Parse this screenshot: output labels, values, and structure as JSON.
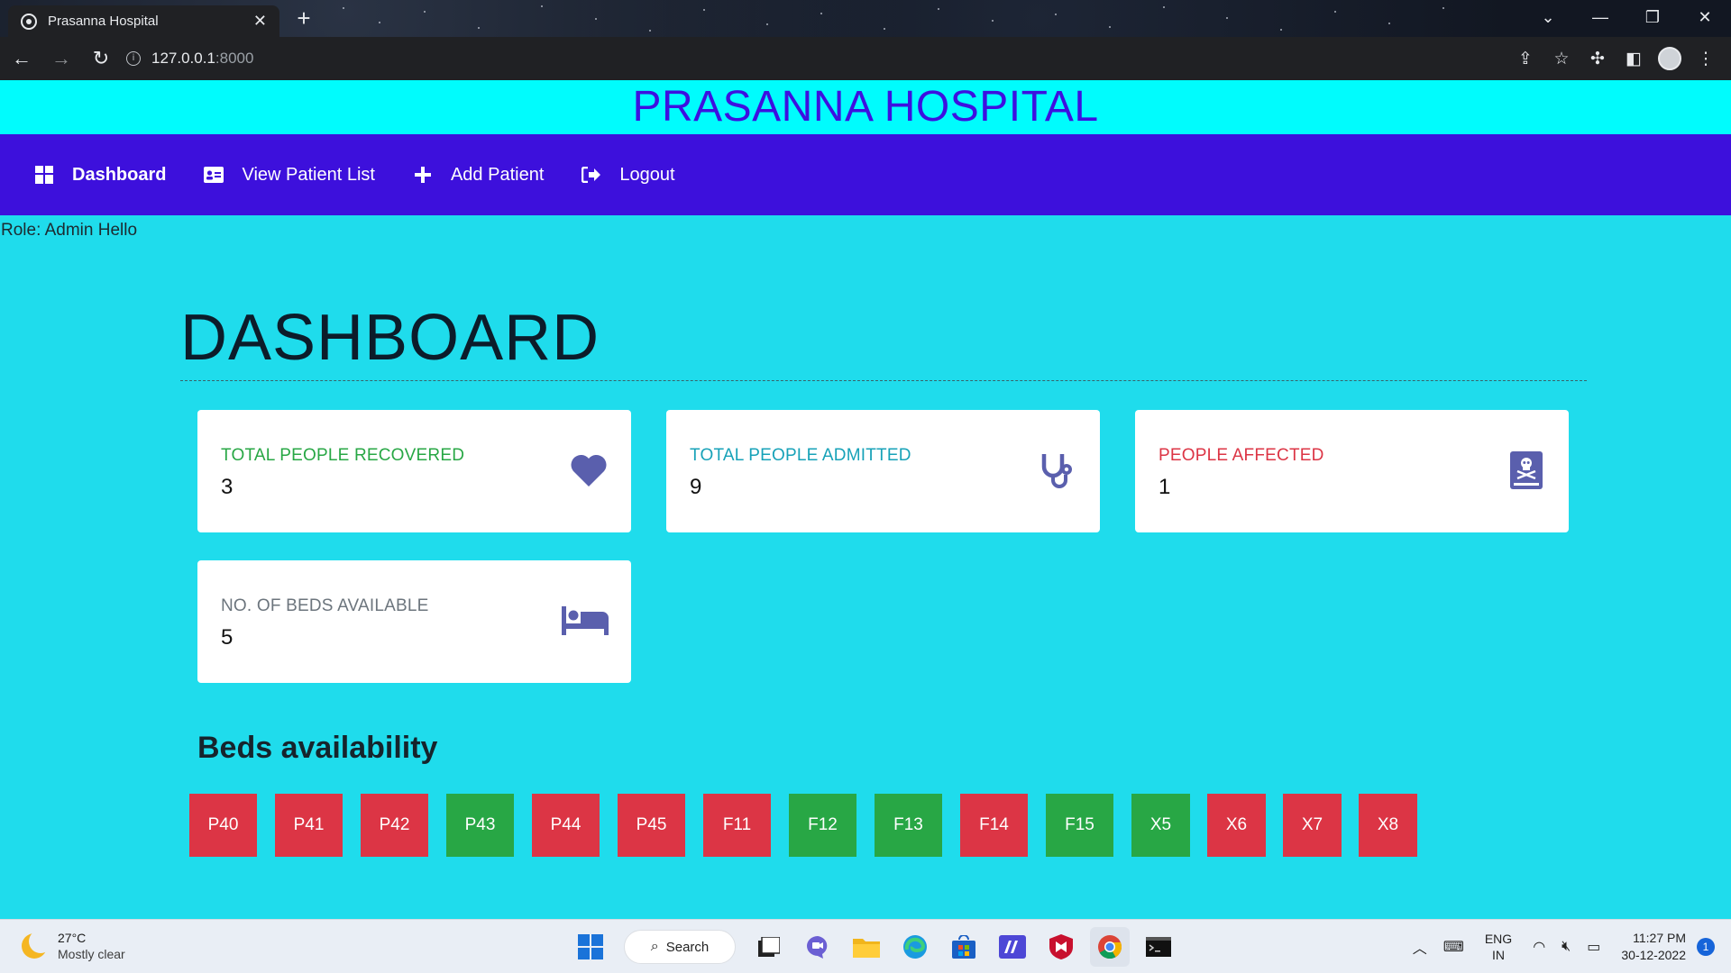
{
  "browser": {
    "tab_title": "Prasanna Hospital",
    "tab_close": "✕",
    "new_tab": "+",
    "url_host": "127.0.0.1",
    "url_port": ":8000"
  },
  "site": {
    "title": "PRASANNA HOSPITAL",
    "nav": [
      {
        "label": "Dashboard",
        "icon": "dashboard-grid-icon",
        "active": true
      },
      {
        "label": "View Patient List",
        "icon": "id-card-icon"
      },
      {
        "label": "Add Patient",
        "icon": "plus-icon"
      },
      {
        "label": "Logout",
        "icon": "sign-out-icon"
      }
    ],
    "role_text": "Role: Admin Hello"
  },
  "dashboard": {
    "heading": "DASHBOARD",
    "cards": [
      {
        "label": "TOTAL PEOPLE RECOVERED",
        "value": "3",
        "icon": "heart-icon",
        "color": "#28a745"
      },
      {
        "label": "TOTAL PEOPLE ADMITTED",
        "value": "9",
        "icon": "stethoscope-icon",
        "color": "#17a2b8"
      },
      {
        "label": "PEOPLE AFFECTED",
        "value": "1",
        "icon": "book-dead-icon",
        "color": "#dc3545"
      },
      {
        "label": "NO. OF BEDS AVAILABLE",
        "value": "5",
        "icon": "bed-icon",
        "color": "#6c757d"
      }
    ],
    "icon_color": "#5a5fad"
  },
  "beds": {
    "heading": "Beds availability",
    "items": [
      {
        "label": "P40",
        "status": "occupied"
      },
      {
        "label": "P41",
        "status": "occupied"
      },
      {
        "label": "P42",
        "status": "occupied"
      },
      {
        "label": "P43",
        "status": "available"
      },
      {
        "label": "P44",
        "status": "occupied"
      },
      {
        "label": "P45",
        "status": "occupied"
      },
      {
        "label": "F11",
        "status": "occupied"
      },
      {
        "label": "F12",
        "status": "available"
      },
      {
        "label": "F13",
        "status": "available"
      },
      {
        "label": "F14",
        "status": "occupied"
      },
      {
        "label": "F15",
        "status": "available"
      },
      {
        "label": "X5",
        "status": "available"
      },
      {
        "label": "X6",
        "status": "occupied"
      },
      {
        "label": "X7",
        "status": "occupied"
      },
      {
        "label": "X8",
        "status": "occupied"
      }
    ],
    "colors": {
      "occupied": "#dc3545",
      "available": "#28a745"
    }
  },
  "taskbar": {
    "weather_temp": "27°C",
    "weather_desc": "Mostly clear",
    "search_label": "Search",
    "lang_1": "ENG",
    "lang_2": "IN",
    "time": "11:27 PM",
    "date": "30-12-2022",
    "notification_count": "1"
  }
}
